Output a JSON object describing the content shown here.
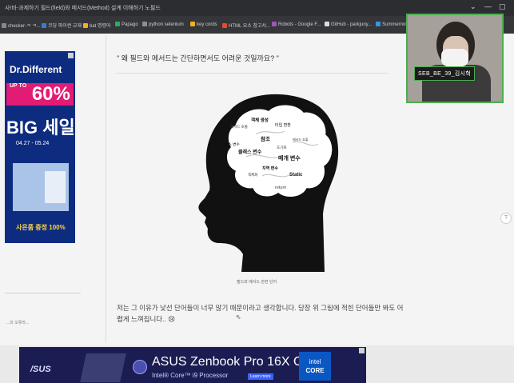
{
  "browser": {
    "tab_title": "사!바-과제하기 필드(field)와 메서드(Method) 설계 이해하기 노필드",
    "controls": [
      "⌄",
      "—",
      "▢"
    ],
    "bookmarks": [
      {
        "label": "checker-ㅋ ㅋ...",
        "color": "#888888"
      },
      {
        "label": "코딩 파이썬 교재",
        "color": "#3a7bd5"
      },
      {
        "label": "bat 명령어",
        "color": "#f2b01e"
      },
      {
        "label": "Papago",
        "color": "#27ae60"
      },
      {
        "label": "python selenium",
        "color": "#8e8e8e"
      },
      {
        "label": "key cords",
        "color": "#f2b01e"
      },
      {
        "label": "HTML 요소 참고서...",
        "color": "#e44d26"
      },
      {
        "label": "Robots - Google F...",
        "color": "#9b59b6"
      },
      {
        "label": "GitHub - parkjuny...",
        "color": "#dddddd"
      },
      {
        "label": "Summernote",
        "color": "#3498db"
      }
    ]
  },
  "left_ad": {
    "brand": "Dr.Different",
    "discount_prefix": "UP TO",
    "discount": "60%",
    "sale": "BIG 세일",
    "dates": "04.27 - 05.24",
    "gift": "사은품 증정 100%"
  },
  "left_snippet": "...의 오류라...",
  "article": {
    "quote": "\" 왜 필드와 메서드는 간단하면서도 어려운 것일까요? \"",
    "caption": "필드와 메서드 관련 단어",
    "paragraph": "저는 그 이유가 낯선 단어들이 너무 많기 때문이라고 생각합니다. 당장 위 그림에 적힌 단어들만 봐도 어렵게 느껴집니다..",
    "emoji": "😢"
  },
  "brain_words": [
    {
      "text": "객체 생성",
      "bold": true
    },
    {
      "text": "메서드 호출",
      "bold": false
    },
    {
      "text": "타입 변환",
      "bold": false
    },
    {
      "text": "인스턴스 변수",
      "bold": false
    },
    {
      "text": "참조",
      "bold": true
    },
    {
      "text": "클래스 변수",
      "bold": true
    },
    {
      "text": "초기화",
      "bold": false
    },
    {
      "text": "메서드 호출",
      "bold": false
    },
    {
      "text": "매개 변수",
      "bold": true
    },
    {
      "text": "지역 변수",
      "bold": true
    },
    {
      "text": "Static",
      "bold": true
    },
    {
      "text": "객체화",
      "bold": false
    },
    {
      "text": "return",
      "bold": false
    }
  ],
  "bottom_ad": {
    "brand": "/SUS",
    "headline": "ASUS Zenbook Pro 16X OLED",
    "subline": "Intel® Core™ i9 Processor",
    "cta": "Learn more",
    "chip_brand": "intel",
    "chip_line": "CORE"
  },
  "webcam": {
    "name_tag": "SEB_BE_39_김시혁"
  },
  "scroll_button": "⊤",
  "cursor": "⇖"
}
